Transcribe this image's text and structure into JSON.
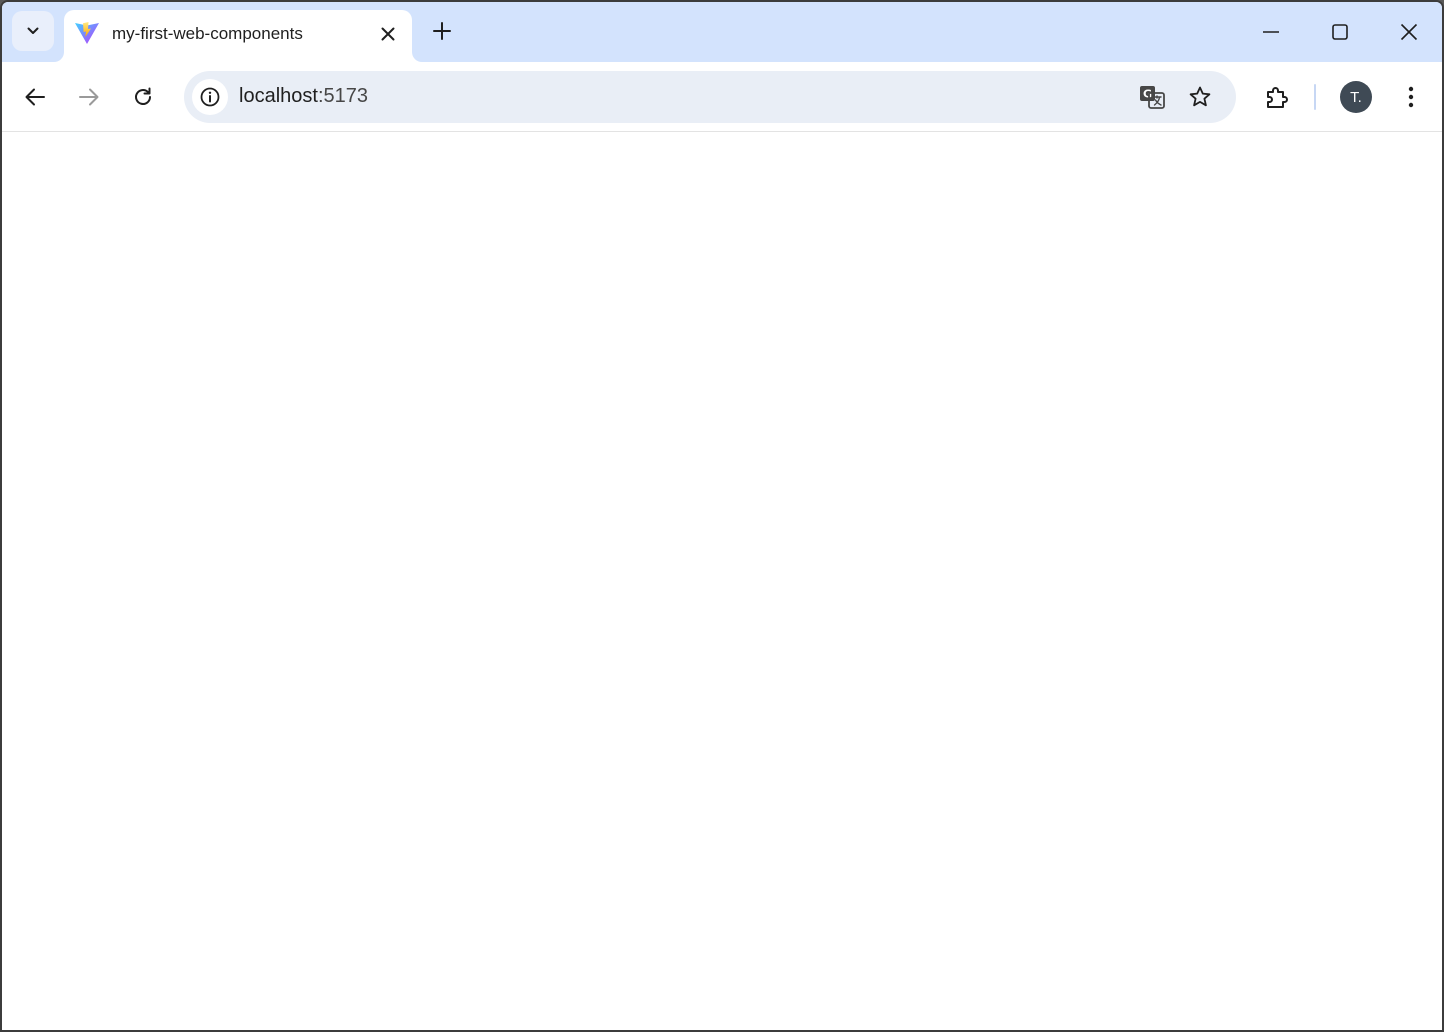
{
  "browser": {
    "tab": {
      "title": "my-first-web-components"
    },
    "address_bar": {
      "host": "localhost",
      "port": ":5173"
    },
    "profile": {
      "initial": "T."
    },
    "icons": {
      "tab_search": "chevron-down-icon",
      "favicon": "vite-logo-icon",
      "tab_close": "close-icon",
      "new_tab": "plus-icon",
      "minimize": "minimize-icon",
      "maximize": "maximize-icon",
      "close_window": "close-icon",
      "back": "arrow-left-icon",
      "forward": "arrow-right-icon",
      "reload": "reload-icon",
      "site_info": "info-icon",
      "translate": "translate-icon",
      "bookmark": "star-icon",
      "extensions": "puzzle-icon",
      "menu": "kebab-menu-icon"
    },
    "colors": {
      "tabstrip": "#d3e3fd",
      "omnibox": "#e9eef6",
      "avatar": "#3f4a55"
    }
  }
}
